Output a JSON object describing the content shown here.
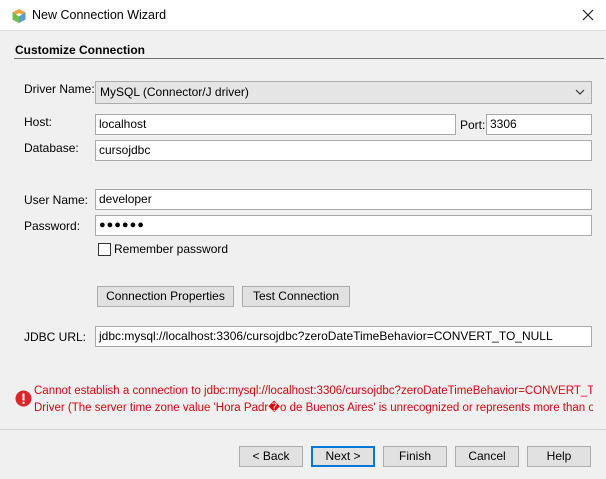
{
  "window": {
    "title": "New Connection Wizard",
    "app_icon": "netbeans-cube-icon",
    "close_icon": "close-icon"
  },
  "section": {
    "title": "Customize Connection"
  },
  "form": {
    "driver_label": "Driver Name:",
    "driver_value": "MySQL (Connector/J driver)",
    "host_label": "Host:",
    "host_value": "localhost",
    "port_label": "Port:",
    "port_value": "3306",
    "database_label": "Database:",
    "database_value": "cursojdbc",
    "user_label": "User Name:",
    "user_value": "developer",
    "password_label": "Password:",
    "password_value": "●●●●●●",
    "remember_label": "Remember password",
    "remember_checked": false,
    "connection_properties_label": "Connection Properties",
    "test_connection_label": "Test Connection",
    "jdbc_label": "JDBC URL:",
    "jdbc_value": "jdbc:mysql://localhost:3306/cursojdbc?zeroDateTimeBehavior=CONVERT_TO_NULL"
  },
  "error": {
    "icon": "error-icon",
    "line1": "Cannot establish a connection to jdbc:mysql://localhost:3306/cursojdbc?zeroDateTimeBehavior=CONVERT_TO_NULL using com.mysql.cj.jdbc.Driver",
    "line2": "Driver (The server time zone value 'Hora Padr�o de Buenos Aires' is unrecognized or represents more than one time zone."
  },
  "buttons": {
    "back": "< Back",
    "next": "Next >",
    "finish": "Finish",
    "cancel": "Cancel",
    "help": "Help"
  },
  "colors": {
    "error": "#e1000f",
    "default_button_border": "#0078d7",
    "dialog_background": "#f0f0f0"
  }
}
